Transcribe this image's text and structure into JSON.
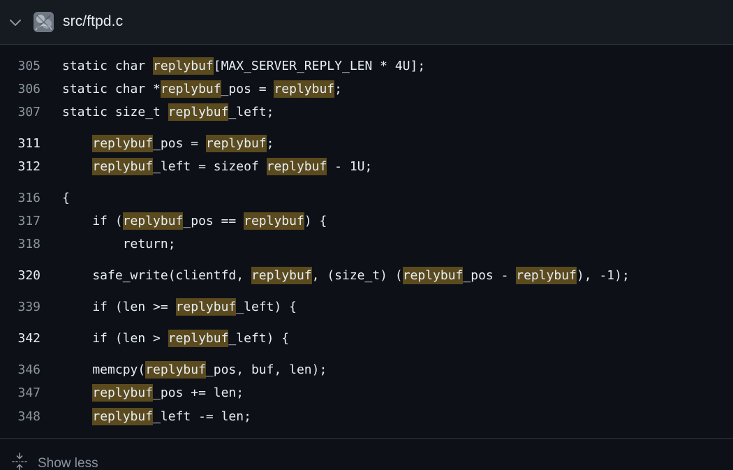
{
  "file": {
    "path": "src/ftpd.c",
    "avatar_icon": "repo-owner-avatar",
    "collapse_icon": "chevron-down-icon"
  },
  "lines": [
    {
      "num": "305",
      "bold": false,
      "parts": [
        {
          "t": "static char "
        },
        {
          "t": "replybuf",
          "hl": true
        },
        {
          "t": "[MAX_SERVER_REPLY_LEN * 4U];"
        }
      ]
    },
    {
      "num": "306",
      "bold": false,
      "parts": [
        {
          "t": "static char *"
        },
        {
          "t": "replybuf",
          "hl": true
        },
        {
          "t": "_pos = "
        },
        {
          "t": "replybuf",
          "hl": true
        },
        {
          "t": ";"
        }
      ]
    },
    {
      "num": "307",
      "bold": false,
      "parts": [
        {
          "t": "static size_t "
        },
        {
          "t": "replybuf",
          "hl": true
        },
        {
          "t": "_left;"
        }
      ]
    },
    {
      "num": "311",
      "bold": true,
      "parts": [
        {
          "t": "    "
        },
        {
          "t": "replybuf",
          "hl": true
        },
        {
          "t": "_pos = "
        },
        {
          "t": "replybuf",
          "hl": true
        },
        {
          "t": ";"
        }
      ]
    },
    {
      "num": "312",
      "bold": true,
      "parts": [
        {
          "t": "    "
        },
        {
          "t": "replybuf",
          "hl": true
        },
        {
          "t": "_left = sizeof "
        },
        {
          "t": "replybuf",
          "hl": true
        },
        {
          "t": " - 1U;"
        }
      ]
    },
    {
      "num": "316",
      "bold": false,
      "parts": [
        {
          "t": "{"
        }
      ]
    },
    {
      "num": "317",
      "bold": false,
      "parts": [
        {
          "t": "    if ("
        },
        {
          "t": "replybuf",
          "hl": true
        },
        {
          "t": "_pos == "
        },
        {
          "t": "replybuf",
          "hl": true
        },
        {
          "t": ") {"
        }
      ]
    },
    {
      "num": "318",
      "bold": false,
      "parts": [
        {
          "t": "        return;"
        }
      ]
    },
    {
      "num": "320",
      "bold": true,
      "parts": [
        {
          "t": "    safe_write(clientfd, "
        },
        {
          "t": "replybuf",
          "hl": true
        },
        {
          "t": ", (size_t) ("
        },
        {
          "t": "replybuf",
          "hl": true
        },
        {
          "t": "_pos - "
        },
        {
          "t": "replybuf",
          "hl": true
        },
        {
          "t": "), -1);"
        }
      ]
    },
    {
      "num": "339",
      "bold": false,
      "parts": [
        {
          "t": "    if (len >= "
        },
        {
          "t": "replybuf",
          "hl": true
        },
        {
          "t": "_left) {"
        }
      ]
    },
    {
      "num": "342",
      "bold": true,
      "parts": [
        {
          "t": "    if (len > "
        },
        {
          "t": "replybuf",
          "hl": true
        },
        {
          "t": "_left) {"
        }
      ]
    },
    {
      "num": "346",
      "bold": false,
      "parts": [
        {
          "t": "    memcpy("
        },
        {
          "t": "replybuf",
          "hl": true
        },
        {
          "t": "_pos, buf, len);"
        }
      ]
    },
    {
      "num": "347",
      "bold": false,
      "parts": [
        {
          "t": "    "
        },
        {
          "t": "replybuf",
          "hl": true
        },
        {
          "t": "_pos += len;"
        }
      ]
    },
    {
      "num": "348",
      "bold": false,
      "parts": [
        {
          "t": "    "
        },
        {
          "t": "replybuf",
          "hl": true
        },
        {
          "t": "_left -= len;"
        }
      ]
    }
  ],
  "footer": {
    "show_less_label": "Show less",
    "fold_icon": "fold-icon"
  },
  "colors": {
    "background": "#0d1117",
    "header_background": "#161b22",
    "border": "#30363d",
    "match_highlight": "#5a4a1e",
    "line_number": "#8b949e",
    "text": "#e6edf3"
  }
}
